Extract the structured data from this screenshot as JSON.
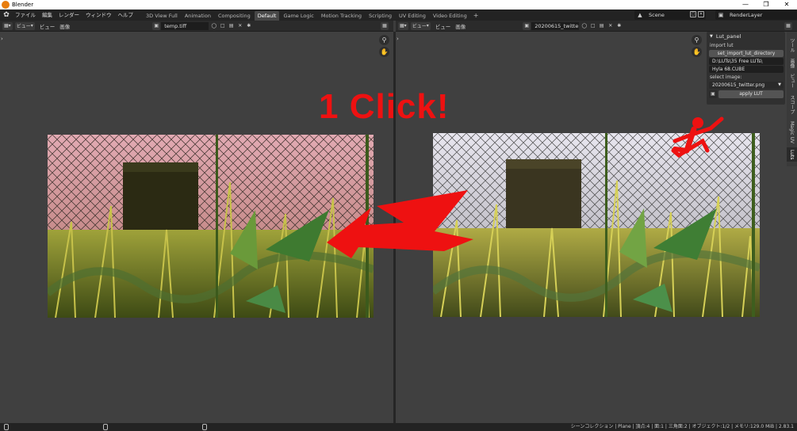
{
  "window": {
    "title": "Blender"
  },
  "menu": [
    "ファイル",
    "編集",
    "レンダー",
    "ウィンドウ",
    "ヘルプ"
  ],
  "workspace_tabs": [
    {
      "label": "3D View Full",
      "active": false
    },
    {
      "label": "Animation",
      "active": false
    },
    {
      "label": "Compositing",
      "active": false
    },
    {
      "label": "Default",
      "active": true
    },
    {
      "label": "Game Logic",
      "active": false
    },
    {
      "label": "Motion Tracking",
      "active": false
    },
    {
      "label": "Scripting",
      "active": false
    },
    {
      "label": "UV Editing",
      "active": false
    },
    {
      "label": "Video Editing",
      "active": false
    }
  ],
  "scene": {
    "label": "Scene"
  },
  "render_layer": {
    "label": "RenderLayer"
  },
  "left_editor": {
    "view_menu": "ビュー",
    "view_menu2": "ビュー",
    "image_menu": "画像",
    "image_name": "temp.tiff"
  },
  "right_editor": {
    "view_menu": "ビュー",
    "view_menu2": "ビュー",
    "image_menu": "画像",
    "image_name": "20200615_twitter..."
  },
  "lut_panel": {
    "title": "Lut_panel",
    "import_label": "import lut",
    "set_dir_button": "set_import_lut_directory",
    "directory": "D:\\LUTs\\35 Free LUTs\\",
    "lut_file": "Hyla 68.CUBE",
    "select_label": "select image:",
    "selected_image": "20200615_twitter.png",
    "apply_button": "apply LUT"
  },
  "sidebar_tabs": [
    {
      "label": "ツール",
      "active": false
    },
    {
      "label": "画像",
      "active": false
    },
    {
      "label": "ビュー",
      "active": false
    },
    {
      "label": "スコープ",
      "active": false
    },
    {
      "label": "Magic UV",
      "active": false
    },
    {
      "label": "Luts",
      "active": true
    }
  ],
  "annotation": {
    "text": "1 Click!",
    "color": "#ee1111"
  },
  "status_bar": {
    "text": "シーンコレクション | Plane | 頂点:4 | 面:1 | 三角面:2 | オブジェクト:1/2 | メモリ:129.0 MiB | 2.83.1"
  },
  "colors": {
    "ui_dark": "#232323",
    "ui_panel": "#303030",
    "viewport": "#404040",
    "accent_red": "#ee1111",
    "active_tab": "#474747"
  }
}
